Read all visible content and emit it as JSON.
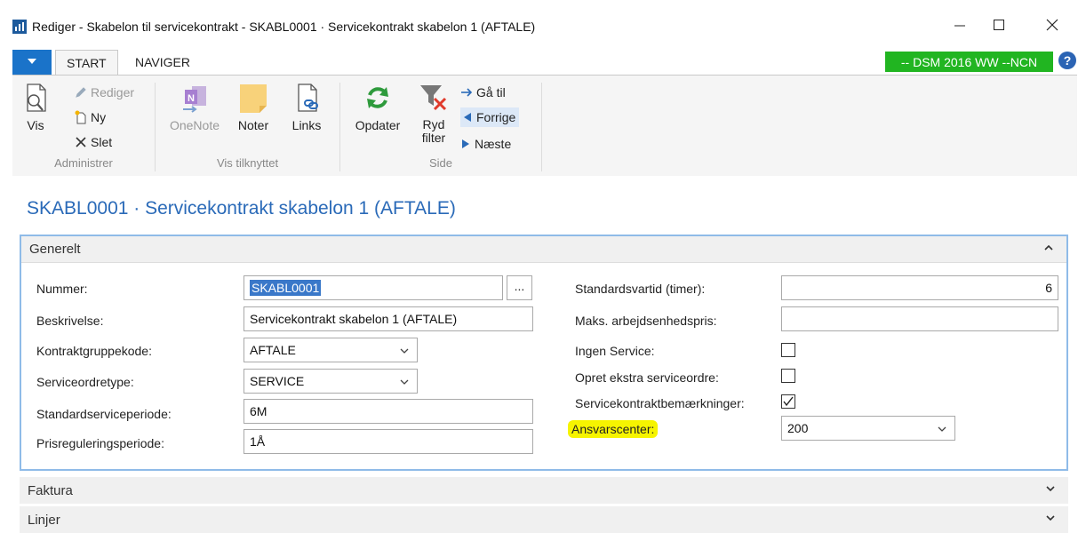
{
  "window": {
    "title": "Rediger - Skabelon til servicekontrakt - SKABL0001 · Servicekontrakt skabelon 1 (AFTALE)",
    "minimize_icon": "minimize-icon",
    "maximize_icon": "maximize-icon",
    "close_icon": "close-icon"
  },
  "ribbon": {
    "tabs": {
      "start": "START",
      "naviger": "NAVIGER"
    },
    "env_badge": "-- DSM 2016 WW --NCN",
    "help": "?",
    "administrer": {
      "label": "Administrer",
      "vis": "Vis",
      "rediger": "Rediger",
      "ny": "Ny",
      "slet": "Slet"
    },
    "vis_tilknyttet": {
      "label": "Vis tilknyttet",
      "onenote": "OneNote",
      "noter": "Noter",
      "links": "Links"
    },
    "side": {
      "label": "Side",
      "opdater": "Opdater",
      "ryd_filter_1": "Ryd",
      "ryd_filter_2": "filter",
      "gaa_til": "Gå til",
      "forrige": "Forrige",
      "naeste": "Næste"
    }
  },
  "page_title": "SKABL0001 · Servicekontrakt skabelon 1 (AFTALE)",
  "generelt": {
    "header": "Generelt",
    "fields_left": [
      {
        "label": "Nummer:",
        "value": "SKABL0001"
      },
      {
        "label": "Beskrivelse:",
        "value": "Servicekontrakt skabelon 1 (AFTALE)"
      },
      {
        "label": "Kontraktgruppekode:",
        "value": "AFTALE"
      },
      {
        "label": "Serviceordretype:",
        "value": "SERVICE"
      },
      {
        "label": "Standardserviceperiode:",
        "value": "6M"
      },
      {
        "label": "Prisreguleringsperiode:",
        "value": "1Å"
      }
    ],
    "fields_right": [
      {
        "label": "Standardsvartid (timer):",
        "value": "6"
      },
      {
        "label": "Maks. arbejdsenhedspris:",
        "value": ""
      },
      {
        "label": "Ingen Service:",
        "checked": false
      },
      {
        "label": "Opret ekstra serviceordre:",
        "checked": false
      },
      {
        "label": "Servicekontraktbemærkninger:",
        "checked": true
      },
      {
        "label": "Ansvarscenter:",
        "value": "200"
      }
    ],
    "ellipsis": "..."
  },
  "faktura": {
    "header": "Faktura"
  },
  "linjer": {
    "header": "Linjer"
  },
  "colors": {
    "accent": "#1a73c9",
    "env_badge": "#21b521",
    "highlight": "#f6f400",
    "title": "#2a6ab8"
  }
}
